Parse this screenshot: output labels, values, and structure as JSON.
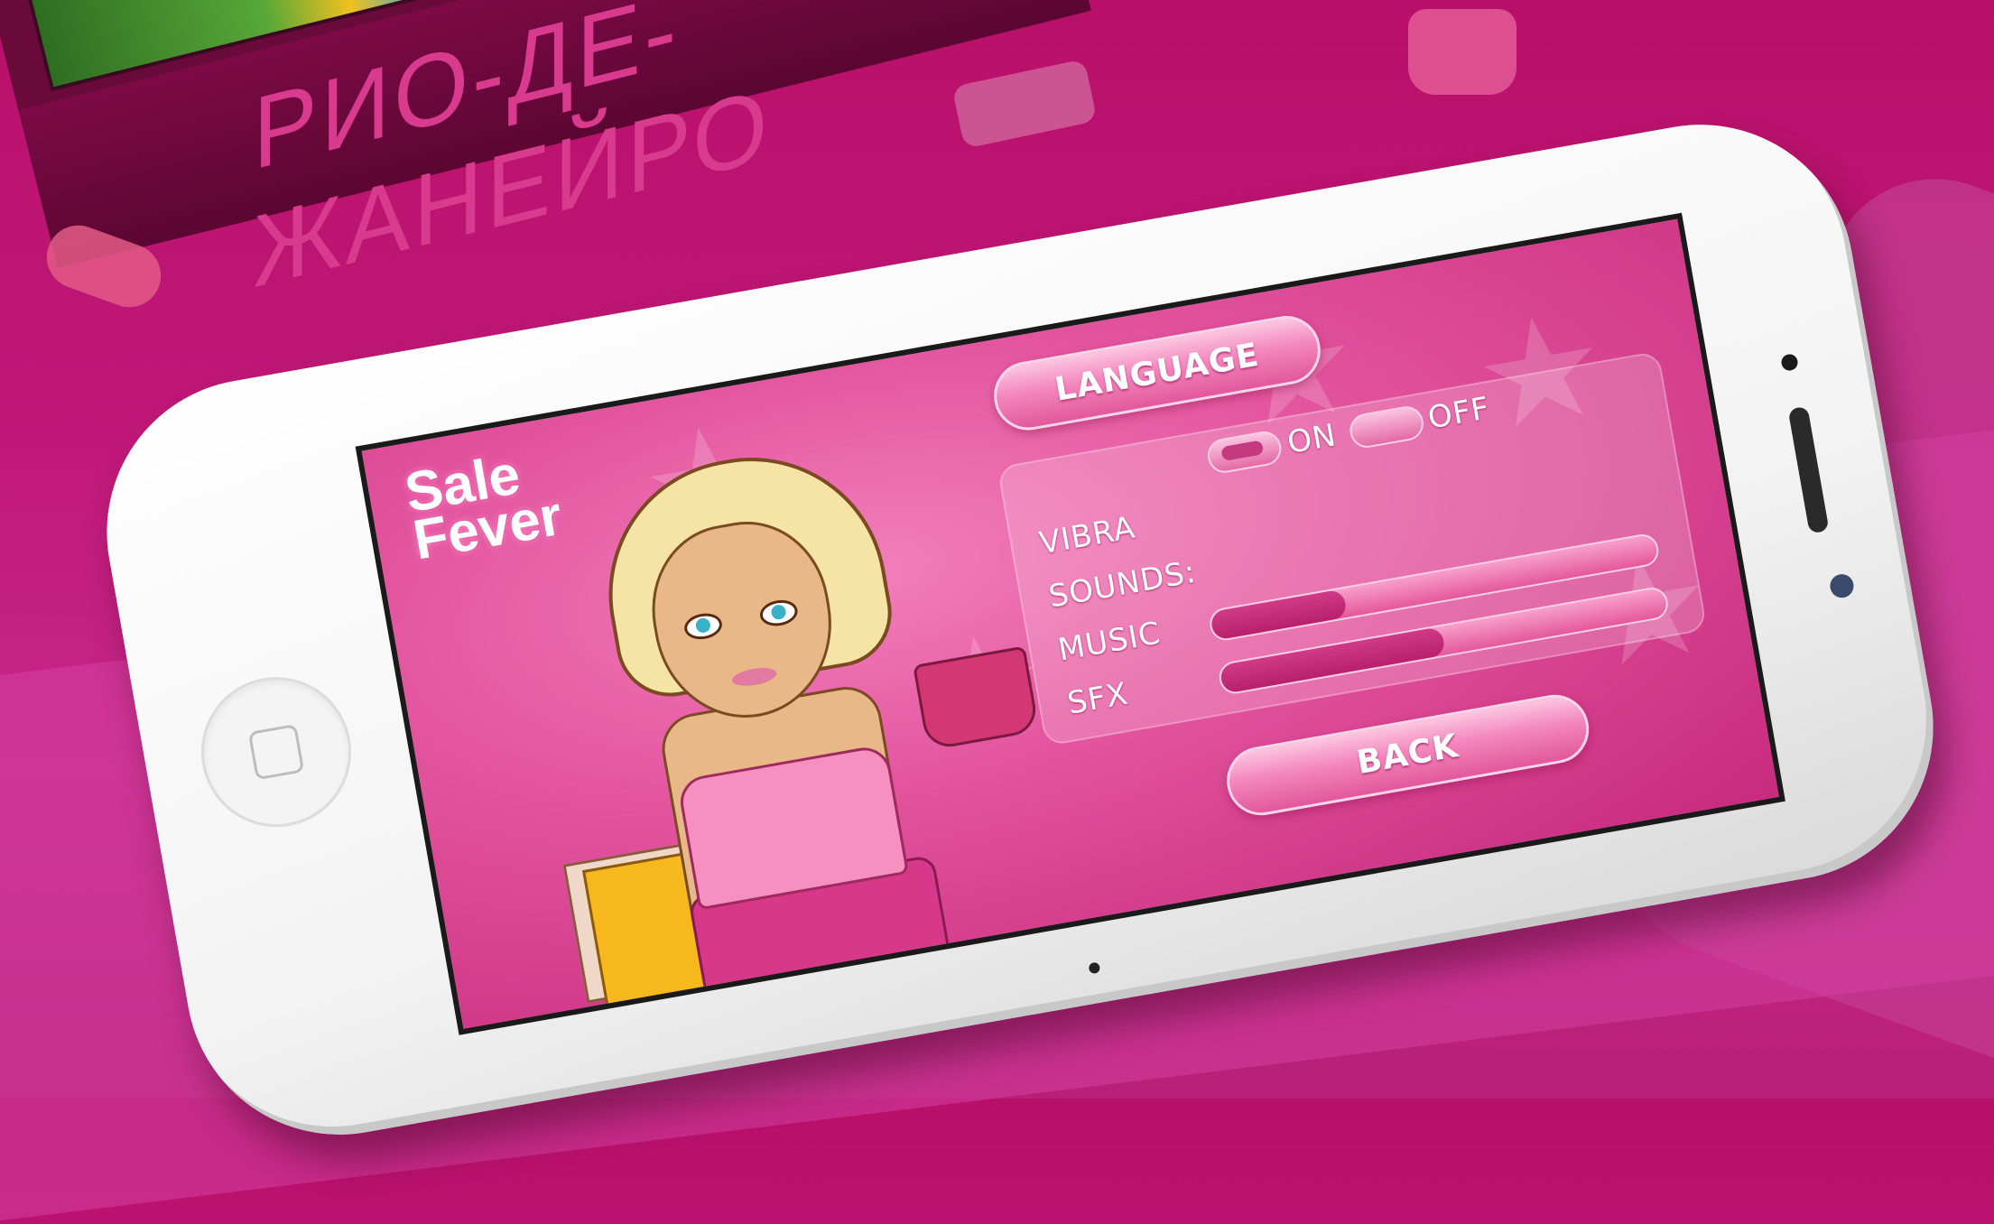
{
  "billboard": {
    "text": "РИО-ДЕ-ЖАНЕЙРО"
  },
  "logo": {
    "line1": "Sale",
    "line2": "Fever"
  },
  "menu": {
    "language_label": "LANGUAGE",
    "back_label": "BACK",
    "vibra_label": "VIBRA",
    "sounds_label": "SOUNDS:",
    "music_label": "MUSIC",
    "sfx_label": "SFX",
    "on_label": "ON",
    "off_label": "OFF",
    "vibra_state": "on",
    "music_level": 0.3,
    "sfx_level": 0.5
  },
  "colors": {
    "background": "#c01878",
    "button": "#f386bd",
    "accent": "#c43a80"
  }
}
